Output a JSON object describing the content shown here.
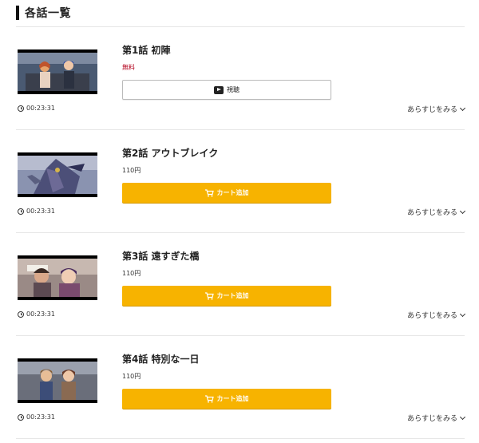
{
  "section": {
    "title": "各話一覧"
  },
  "episodes": [
    {
      "title": "第1話 初陣",
      "price": "無料",
      "button_label": "視聴",
      "duration": "00:23:31",
      "synopsis_label": "あらすじをみる"
    },
    {
      "title": "第2話 アウトブレイク",
      "price": "110円",
      "button_label": "カート追加",
      "duration": "00:23:31",
      "synopsis_label": "あらすじをみる"
    },
    {
      "title": "第3話 遠すぎた橋",
      "price": "110円",
      "button_label": "カート追加",
      "duration": "00:23:31",
      "synopsis_label": "あらすじをみる"
    },
    {
      "title": "第4話 特別な一日",
      "price": "110円",
      "button_label": "カート追加",
      "duration": "00:23:31",
      "synopsis_label": "あらすじをみる"
    }
  ],
  "colors": {
    "cart_button": "#f7b300",
    "free_price": "#b3001b",
    "divider": "#e6e6e6"
  },
  "icons": {
    "watch": "play-icon",
    "cart": "cart-icon",
    "duration": "clock-icon",
    "expand": "chevron-down-icon"
  }
}
